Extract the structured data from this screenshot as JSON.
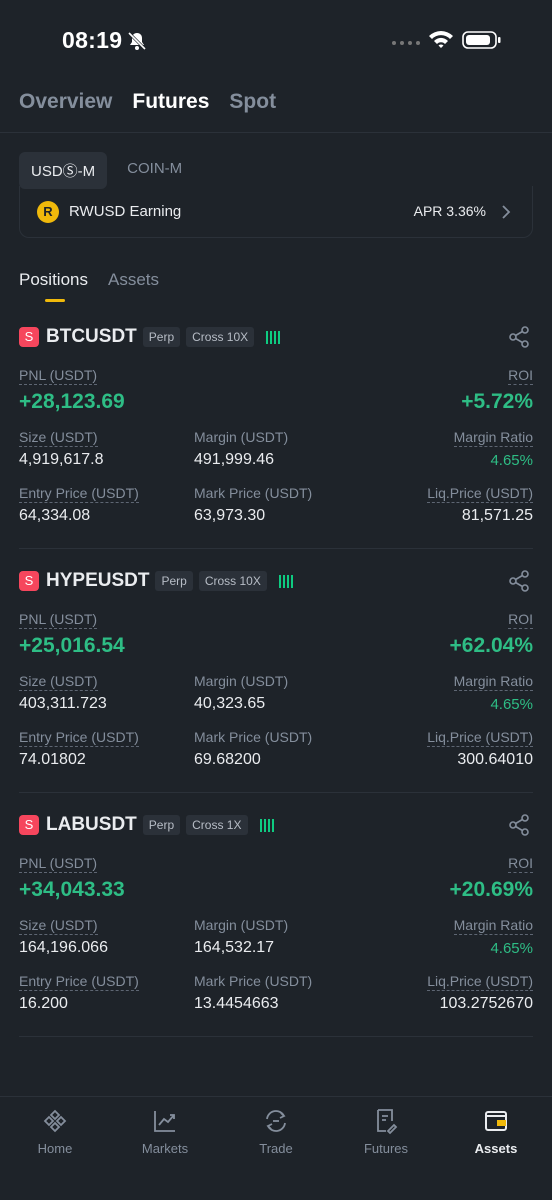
{
  "status_bar": {
    "time": "08:19"
  },
  "top_tabs": [
    "Overview",
    "Futures",
    "Spot"
  ],
  "sub_tabs": [
    "USDⓈ-M",
    "COIN-M"
  ],
  "earn": {
    "logo_letter": "R",
    "name": "RWUSD Earning",
    "apr": "APR 3.36%"
  },
  "position_tabs": [
    "Positions",
    "Assets"
  ],
  "labels": {
    "pnl": "PNL (USDT)",
    "roi": "ROI",
    "size": "Size (USDT)",
    "margin": "Margin (USDT)",
    "margin_ratio": "Margin Ratio",
    "entry_price": "Entry Price (USDT)",
    "mark_price": "Mark Price (USDT)",
    "liq_price": "Liq.Price (USDT)"
  },
  "positions": [
    {
      "side": "S",
      "symbol": "BTCUSDT",
      "type": "Perp",
      "mode": "Cross 10X",
      "pnl": "+28,123.69",
      "roi": "+5.72%",
      "size": "4,919,617.8",
      "margin": "491,999.46",
      "margin_ratio": "4.65%",
      "entry_price": "64,334.08",
      "mark_price": "63,973.30",
      "liq_price": "81,571.25"
    },
    {
      "side": "S",
      "symbol": "HYPEUSDT",
      "type": "Perp",
      "mode": "Cross 10X",
      "pnl": "+25,016.54",
      "roi": "+62.04%",
      "size": "403,311.723",
      "margin": "40,323.65",
      "margin_ratio": "4.65%",
      "entry_price": "74.01802",
      "mark_price": "69.68200",
      "liq_price": "300.64010"
    },
    {
      "side": "S",
      "symbol": "LABUSDT",
      "type": "Perp",
      "mode": "Cross 1X",
      "pnl": "+34,043.33",
      "roi": "+20.69%",
      "size": "164,196.066",
      "margin": "164,532.17",
      "margin_ratio": "4.65%",
      "entry_price": "16.200",
      "mark_price": "13.4454663",
      "liq_price": "103.2752670"
    }
  ],
  "bottom_nav": [
    "Home",
    "Markets",
    "Trade",
    "Futures",
    "Assets"
  ],
  "colors": {
    "background": "#1e2329",
    "accent": "#f0b90b",
    "profit": "#2ebd85",
    "short": "#f6465d"
  },
  "icons": {
    "status": [
      "bell-muted-icon",
      "signal-dots-icon",
      "wifi-icon",
      "battery-icon"
    ],
    "earn": [
      "rwusd-logo-icon",
      "chevron-right-icon"
    ],
    "position": [
      "share-icon",
      "adl-indicator-icon"
    ],
    "nav": [
      "home-icon",
      "markets-icon",
      "trade-icon",
      "futures-icon",
      "assets-icon"
    ]
  }
}
